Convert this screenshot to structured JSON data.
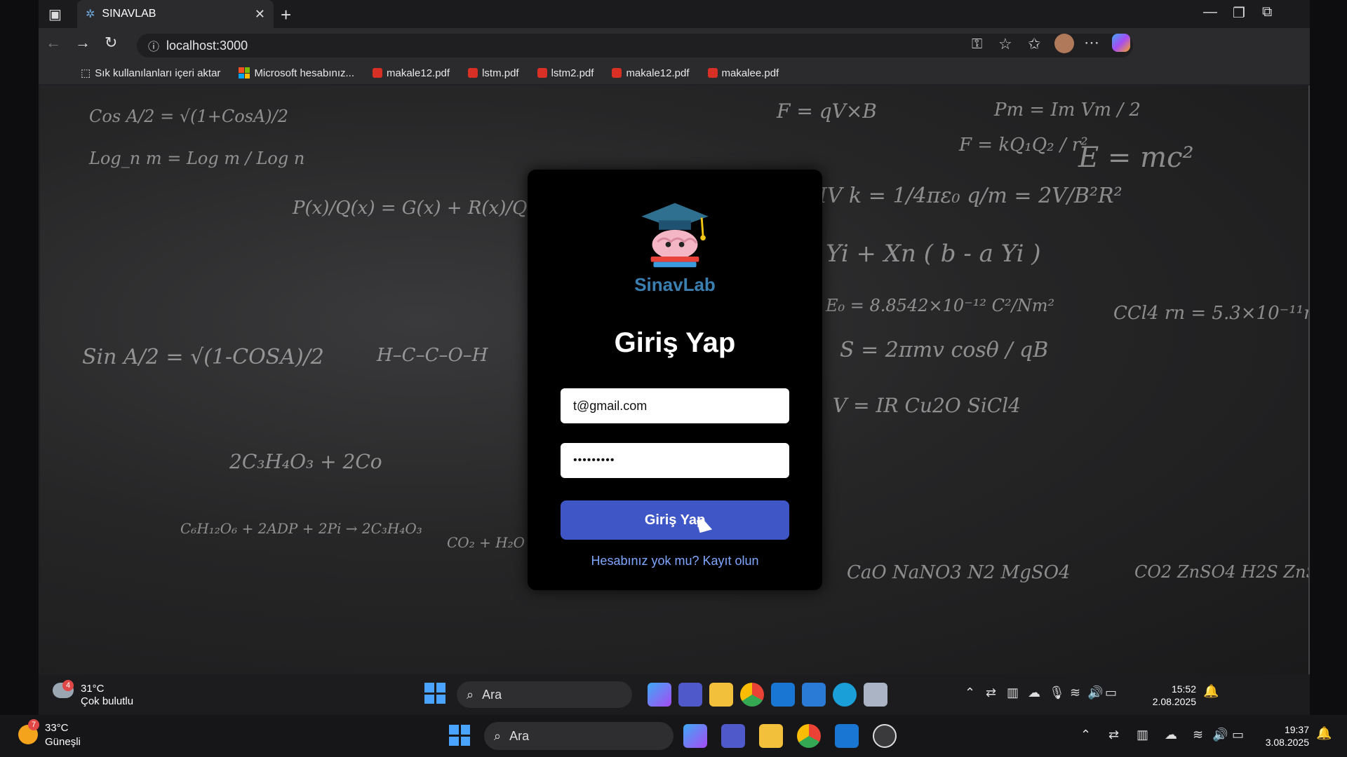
{
  "browser": {
    "tab_title": "SINAVLAB",
    "url": "localhost:3000",
    "bookmarks": [
      {
        "label": "Sık kullanılanları içeri aktar",
        "icon": "import-icon"
      },
      {
        "label": "Microsoft hesabınız...",
        "icon": "microsoft-icon"
      },
      {
        "label": "makale12.pdf",
        "icon": "pdf-icon"
      },
      {
        "label": "lstm.pdf",
        "icon": "pdf-icon"
      },
      {
        "label": "lstm2.pdf",
        "icon": "pdf-icon"
      },
      {
        "label": "makale12.pdf",
        "icon": "pdf-icon"
      },
      {
        "label": "makalee.pdf",
        "icon": "pdf-icon"
      }
    ]
  },
  "login": {
    "logo_text": "SinavLab",
    "title": "Giriş Yap",
    "email_value": "t@gmail.com",
    "password_value": "•••••••••",
    "submit_label": "Giriş Yap",
    "register_link": "Hesabınız yok mu? Kayıt olun",
    "submit_color": "#3f56c7",
    "link_color": "#7fa6ff"
  },
  "inner_taskbar": {
    "weather_temp": "31°C",
    "weather_desc": "Çok bulutlu",
    "weather_badge": "4",
    "search_placeholder": "Ara",
    "time": "15:52",
    "date": "2.08.2025"
  },
  "outer_taskbar": {
    "weather_temp": "33°C",
    "weather_desc": "Güneşli",
    "weather_badge": "7",
    "search_placeholder": "Ara",
    "time": "19:37",
    "date": "3.08.2025"
  }
}
